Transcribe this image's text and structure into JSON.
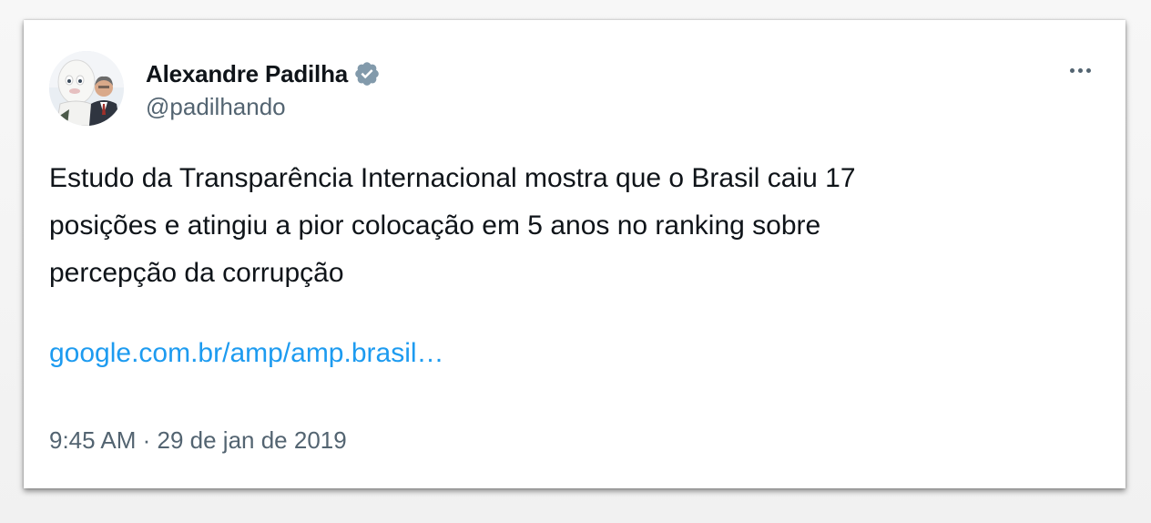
{
  "author": {
    "name": "Alexandre Padilha",
    "handle": "@padilhando",
    "verified": true
  },
  "tweet": {
    "text": "Estudo da Transparência Internacional mostra que o Brasil caiu 17\nposições e atingiu a pior colocação em 5 anos no ranking sobre\npercepção da corrupção",
    "link": "google.com.br/amp/amp.brasil…",
    "time": "9:45 AM",
    "separator": " · ",
    "date": "29 de jan de 2019"
  },
  "icons": {
    "more": "more-horizontal-icon",
    "verified": "verified-badge-icon"
  },
  "colors": {
    "text": "#0f1419",
    "secondary": "#536471",
    "link": "#1d9bf0",
    "badge": "#829aab"
  }
}
